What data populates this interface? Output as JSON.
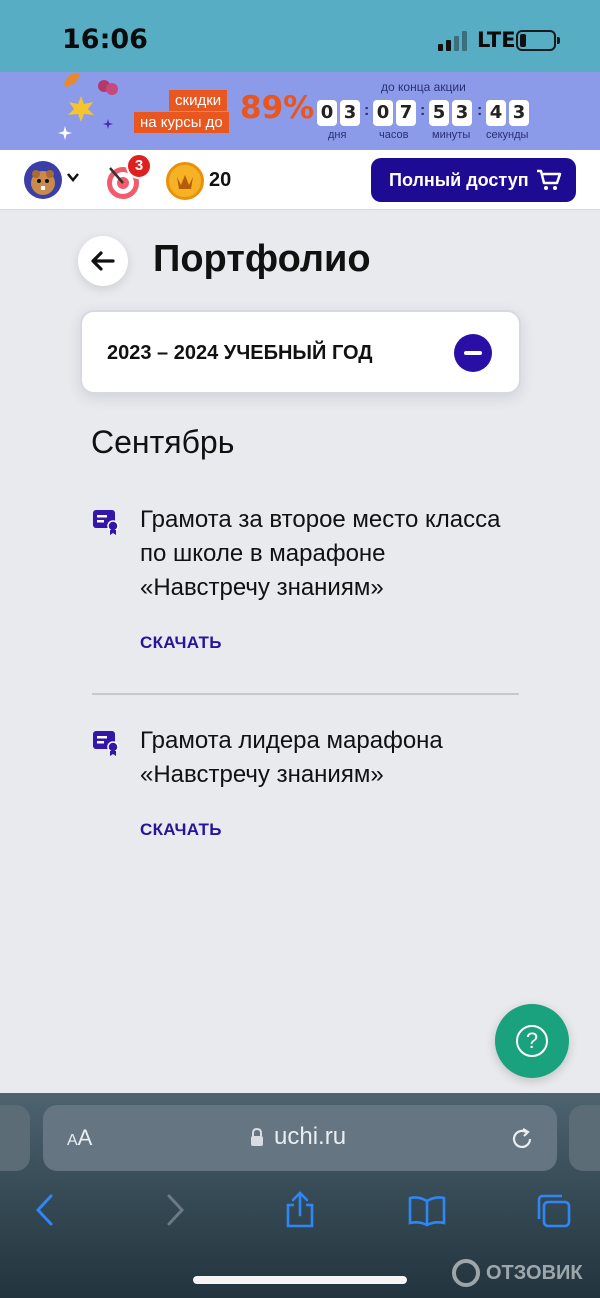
{
  "status_bar": {
    "time": "16:06",
    "network": "LTE"
  },
  "promo": {
    "tag_line1": "скидки",
    "tag_line2": "на курсы до",
    "percent": "89%",
    "until_label": "до конца акции",
    "timer_digits": [
      "0",
      "3",
      "0",
      "7",
      "5",
      "3",
      "4",
      "3"
    ],
    "units": {
      "days": "дня",
      "hours": "часов",
      "minutes": "минуты",
      "seconds": "секунды"
    }
  },
  "header": {
    "notification_count": "3",
    "coins": "20",
    "full_access_label": "Полный доступ"
  },
  "page": {
    "title": "Портфолио",
    "year_label": "2023 – 2024 УЧЕБНЫЙ ГОД",
    "month": "Сентябрь",
    "certificates": [
      {
        "title": "Грамота за второе место класса по школе в марафоне «Навстречу знаниям»",
        "download_label": "СКАЧАТЬ"
      },
      {
        "title": "Грамота лидера марафона «Навстречу знаниям»",
        "download_label": "СКАЧАТЬ"
      }
    ],
    "help_label": "?"
  },
  "browser": {
    "text_size_small": "A",
    "text_size_large": "A",
    "url": "uchi.ru"
  },
  "watermark": "ОТЗОВИК",
  "colors": {
    "status_bar": "#57aec4",
    "promo_bg": "#8b9ae9",
    "promo_accent": "#e8571f",
    "primary": "#1d0b93",
    "help_button": "#1aa27e"
  }
}
